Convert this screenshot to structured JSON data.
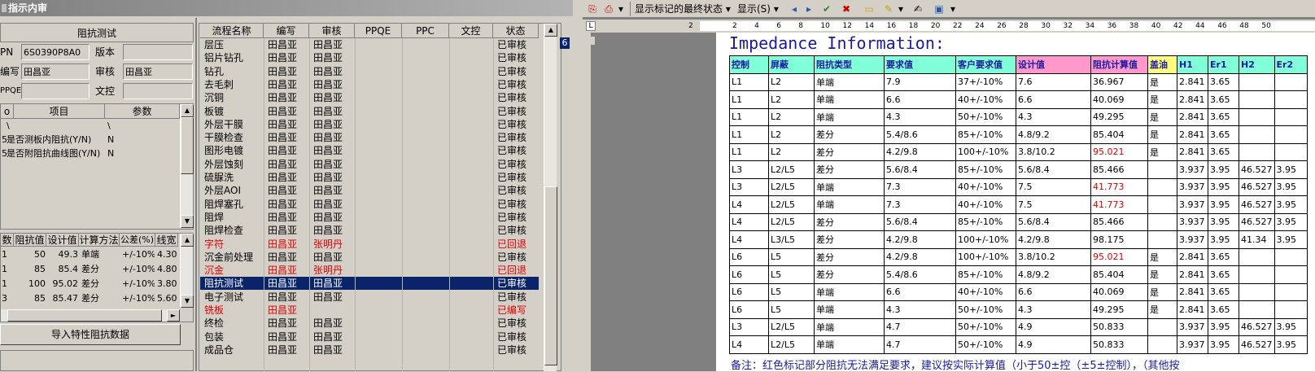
{
  "left_window": {
    "title": "指示内审",
    "panel_title": "阻抗测试",
    "fields": {
      "pn_label": "PN",
      "pn_value": "6S0390P8A0",
      "version_label": "版本",
      "version_value": "",
      "writer_label": "编写",
      "writer_value": "田昌亚",
      "reviewer_label": "审核",
      "reviewer_value": "田昌亚",
      "ppqe_label": "PPQE",
      "ppqe_value": "",
      "doc_control_label": "文控",
      "doc_control_value": ""
    },
    "item_grid": {
      "headers": [
        "项目",
        "参数"
      ],
      "rows": [
        {
          "no": "",
          "item": "\\",
          "param": "\\"
        },
        {
          "no": "5",
          "item": "是否测板内阻抗(Y/N)",
          "param": "N"
        },
        {
          "no": "5",
          "item": "是否附阻抗曲线图(Y/N)",
          "param": "N"
        }
      ]
    },
    "impedance_grid": {
      "headers": [
        "数",
        "阻抗值",
        "设计值",
        "计算方法",
        "公差(%)",
        "线宽"
      ],
      "rows": [
        [
          "1",
          "50",
          "49.3",
          "单端",
          "+/-10%",
          "4.30"
        ],
        [
          "1",
          "85",
          "85.4",
          "差分",
          "+/-10%",
          "4.80"
        ],
        [
          "1",
          "100",
          "95.02",
          "差分",
          "+/-10%",
          "3.80"
        ],
        [
          "3",
          "85",
          "85.47",
          "差分",
          "+/-10%",
          "5.60"
        ]
      ]
    },
    "import_button": "导入特性阻抗数据"
  },
  "process_table": {
    "headers": [
      "流程名称",
      "编写",
      "审核",
      "PPQE",
      "PPC",
      "文控",
      "状态"
    ],
    "rows": [
      {
        "name": "层压",
        "writer": "田昌亚",
        "reviewer": "田昌亚",
        "status": "已审核",
        "style": "normal"
      },
      {
        "name": "铝片钻孔",
        "writer": "田昌亚",
        "reviewer": "田昌亚",
        "status": "已审核",
        "style": "normal"
      },
      {
        "name": "钻孔",
        "writer": "田昌亚",
        "reviewer": "田昌亚",
        "status": "已审核",
        "style": "normal"
      },
      {
        "name": "去毛刺",
        "writer": "田昌亚",
        "reviewer": "田昌亚",
        "status": "已审核",
        "style": "normal"
      },
      {
        "name": "沉铜",
        "writer": "田昌亚",
        "reviewer": "田昌亚",
        "status": "已审核",
        "style": "normal"
      },
      {
        "name": "板镀",
        "writer": "田昌亚",
        "reviewer": "田昌亚",
        "status": "已审核",
        "style": "normal"
      },
      {
        "name": "外层干膜",
        "writer": "田昌亚",
        "reviewer": "田昌亚",
        "status": "已审核",
        "style": "normal"
      },
      {
        "name": "干膜检查",
        "writer": "田昌亚",
        "reviewer": "田昌亚",
        "status": "已审核",
        "style": "normal"
      },
      {
        "name": "图形电镀",
        "writer": "田昌亚",
        "reviewer": "田昌亚",
        "status": "已审核",
        "style": "normal"
      },
      {
        "name": "外层蚀刻",
        "writer": "田昌亚",
        "reviewer": "田昌亚",
        "status": "已审核",
        "style": "normal"
      },
      {
        "name": "硫脲洗",
        "writer": "田昌亚",
        "reviewer": "田昌亚",
        "status": "已审核",
        "style": "normal"
      },
      {
        "name": "外层AOI",
        "writer": "田昌亚",
        "reviewer": "田昌亚",
        "status": "已审核",
        "style": "normal"
      },
      {
        "name": "阻焊塞孔",
        "writer": "田昌亚",
        "reviewer": "田昌亚",
        "status": "已审核",
        "style": "normal"
      },
      {
        "name": "阻焊",
        "writer": "田昌亚",
        "reviewer": "田昌亚",
        "status": "已审核",
        "style": "normal"
      },
      {
        "name": "阻焊检查",
        "writer": "田昌亚",
        "reviewer": "田昌亚",
        "status": "已审核",
        "style": "normal"
      },
      {
        "name": "字符",
        "writer": "田昌亚",
        "reviewer": "张明丹",
        "status": "已回退",
        "style": "red"
      },
      {
        "name": "沉金前处理",
        "writer": "田昌亚",
        "reviewer": "田昌亚",
        "status": "已审核",
        "style": "normal"
      },
      {
        "name": "沉金",
        "writer": "田昌亚",
        "reviewer": "张明丹",
        "status": "已回退",
        "style": "red"
      },
      {
        "name": "阻抗测试",
        "writer": "田昌亚",
        "reviewer": "田昌亚",
        "status": "已审核",
        "style": "sel"
      },
      {
        "name": "电子测试",
        "writer": "田昌亚",
        "reviewer": "田昌亚",
        "status": "已审核",
        "style": "normal"
      },
      {
        "name": "铣板",
        "writer": "田昌亚",
        "reviewer": "",
        "status": "已编写",
        "style": "red"
      },
      {
        "name": "终检",
        "writer": "田昌亚",
        "reviewer": "田昌亚",
        "status": "已审核",
        "style": "normal"
      },
      {
        "name": "包装",
        "writer": "田昌亚",
        "reviewer": "田昌亚",
        "status": "已审核",
        "style": "normal"
      },
      {
        "name": "成品仓",
        "writer": "田昌亚",
        "reviewer": "田昌亚",
        "status": "已审核",
        "style": "normal"
      }
    ],
    "side_digit": "6"
  },
  "word_window": {
    "markup_view": "显示标记的最终状态",
    "show_menu": "显示(S)",
    "ruler_numbers": [
      "2",
      "2",
      "4",
      "6",
      "8",
      "10",
      "12",
      "14",
      "16",
      "18",
      "20",
      "22",
      "24",
      "26",
      "28",
      "30",
      "32",
      "34",
      "36",
      "38",
      "40",
      "42",
      "44",
      "46",
      "48",
      "50"
    ],
    "doc_title": "Impedance Information:",
    "headers": [
      "控制",
      "屏蔽",
      "阻抗类型",
      "要求值",
      "客户要求值",
      "设计值",
      "阻抗计算值",
      "盖油",
      "H1",
      "Er1",
      "H2",
      "Er2"
    ],
    "rows": [
      [
        "L1",
        "L2",
        "单端",
        "7.9",
        "37+/-10%",
        "7.6",
        "36.967",
        "是",
        "2.841",
        "3.65",
        "",
        ""
      ],
      [
        "L1",
        "L2",
        "单端",
        "6.6",
        "40+/-10%",
        "6.6",
        "40.069",
        "是",
        "2.841",
        "3.65",
        "",
        ""
      ],
      [
        "L1",
        "L2",
        "单端",
        "4.3",
        "50+/-10%",
        "4.3",
        "49.295",
        "是",
        "2.841",
        "3.65",
        "",
        ""
      ],
      [
        "L1",
        "L2",
        "差分",
        "5.4/8.6",
        "85+/-10%",
        "4.8/9.2",
        "85.404",
        "是",
        "2.841",
        "3.65",
        "",
        ""
      ],
      [
        "L1",
        "L2",
        "差分",
        "4.2/9.8",
        "100+/-10%",
        "3.8/10.2",
        "95.021",
        "是",
        "2.841",
        "3.65",
        "",
        ""
      ],
      [
        "L3",
        "L2/L5",
        "差分",
        "5.6/8.4",
        "85+/-10%",
        "5.6/8.4",
        "85.466",
        "",
        "3.937",
        "3.95",
        "46.527",
        "3.95"
      ],
      [
        "L3",
        "L2/L5",
        "单端",
        "7.3",
        "40+/-10%",
        "7.5",
        "41.773",
        "",
        "3.937",
        "3.95",
        "46.527",
        "3.95"
      ],
      [
        "L4",
        "L2/L5",
        "单端",
        "7.3",
        "40+/-10%",
        "7.5",
        "41.773",
        "",
        "3.937",
        "3.95",
        "46.527",
        "3.95"
      ],
      [
        "L4",
        "L2/L5",
        "差分",
        "5.6/8.4",
        "85+/-10%",
        "5.6/8.4",
        "85.466",
        "",
        "3.937",
        "3.95",
        "46.527",
        "3.95"
      ],
      [
        "L4",
        "L3/L5",
        "差分",
        "4.2/9.8",
        "100+/-10%",
        "4.2/9.8",
        "98.175",
        "",
        "3.937",
        "3.95",
        "41.34",
        "3.95"
      ],
      [
        "L6",
        "L5",
        "差分",
        "4.2/9.8",
        "100+/-10%",
        "3.8/10.2",
        "95.021",
        "是",
        "2.841",
        "3.65",
        "",
        ""
      ],
      [
        "L6",
        "L5",
        "差分",
        "5.4/8.6",
        "85+/-10%",
        "4.8/9.2",
        "85.404",
        "是",
        "2.841",
        "3.65",
        "",
        ""
      ],
      [
        "L6",
        "L5",
        "单端",
        "6.6",
        "40+/-10%",
        "6.6",
        "40.069",
        "是",
        "2.841",
        "3.65",
        "",
        ""
      ],
      [
        "L6",
        "L5",
        "单端",
        "4.3",
        "50+/-10%",
        "4.3",
        "49.295",
        "是",
        "2.841",
        "3.65",
        "",
        ""
      ],
      [
        "L3",
        "L2/L5",
        "单端",
        "4.7",
        "50+/-10%",
        "4.9",
        "50.833",
        "",
        "3.937",
        "3.95",
        "46.527",
        "3.95"
      ],
      [
        "L4",
        "L2/L5",
        "单端",
        "4.7",
        "50+/-10%",
        "4.9",
        "50.833",
        "",
        "3.937",
        "3.95",
        "46.527",
        "3.95"
      ]
    ],
    "red_cells": [
      [
        4,
        6
      ],
      [
        6,
        6
      ],
      [
        7,
        6
      ],
      [
        10,
        6
      ]
    ],
    "note": "备注：红色标记部分阻抗无法满足要求，建议按实际计算值（小于50±控（±5±控制），（其他按"
  }
}
